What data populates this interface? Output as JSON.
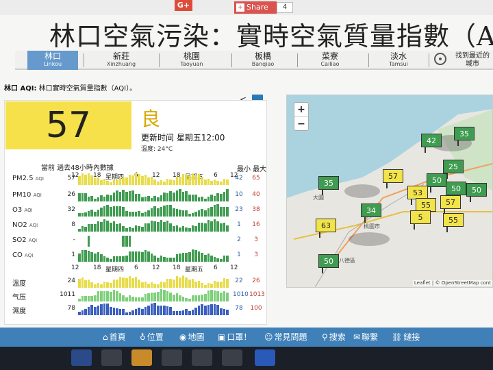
{
  "toolbar": {
    "gplus": "G+",
    "share_label": "Share",
    "share_count": "4"
  },
  "page_title": "林口空氣污染：實時空氣質量指數（AQ",
  "nav": [
    {
      "zh": "林口",
      "en": "Linkou"
    },
    {
      "zh": "新莊",
      "en": "Xinzhuang"
    },
    {
      "zh": "桃園",
      "en": "Taoyuan"
    },
    {
      "zh": "板橋",
      "en": "Banqiao"
    },
    {
      "zh": "菜寮",
      "en": "Cailiao"
    },
    {
      "zh": "淡水",
      "en": "Tamsui"
    },
    {
      "zh": "找到最近的城市",
      "en": ""
    }
  ],
  "panel": {
    "heading_city": "林口 AQI:",
    "heading_text": "林口實時空氣質量指數（AQI）。",
    "aqi": "57",
    "level": "良",
    "updated": "更新时间 星期五12:00",
    "temperature": "溫度: 24°C",
    "chart_heading": "當前  過去48小時內數據",
    "minmax_heading": "最小 最大",
    "ticks_top": [
      "12",
      "18",
      "星期四",
      "6",
      "12",
      "18",
      "星期五",
      "6",
      "12"
    ],
    "ticks_mid": [
      "12",
      "18",
      "星期四",
      "6",
      "12",
      "18",
      "星期五",
      "6",
      "12"
    ],
    "rows": [
      {
        "label": "PM2.5",
        "unit": "AQI",
        "current": "57",
        "min": "42",
        "max": "65",
        "color": "#e8dc4a"
      },
      {
        "label": "PM10",
        "unit": "AQI",
        "current": "26",
        "min": "10",
        "max": "40",
        "color": "#3f9c50"
      },
      {
        "label": "O3",
        "unit": "AQI",
        "current": "32",
        "min": "23",
        "max": "38",
        "color": "#3f9c50"
      },
      {
        "label": "NO2",
        "unit": "AQI",
        "current": "8",
        "min": "1",
        "max": "16",
        "color": "#3f9c50"
      },
      {
        "label": "SO2",
        "unit": "AQI",
        "current": "-",
        "min": "2",
        "max": "3",
        "color": "#3f9c50"
      },
      {
        "label": "CO",
        "unit": "AQI",
        "current": "1",
        "min": "1",
        "max": "3",
        "color": "#3f9c50"
      },
      {
        "label": "溫度",
        "unit": "",
        "current": "24",
        "min": "22",
        "max": "26",
        "color": "#e8dc4a"
      },
      {
        "label": "气压",
        "unit": "",
        "current": "1011",
        "min": "1010",
        "max": "1013",
        "color": "#7ed07a"
      },
      {
        "label": "濕度",
        "unit": "",
        "current": "78",
        "min": "78",
        "max": "100",
        "color": "#3a5fbf"
      }
    ]
  },
  "map": {
    "zoom_in": "+",
    "zoom_out": "−",
    "attribution": "Leaflet | © OpenStreetMap cont",
    "labels": {
      "taoyuan": "桃園市",
      "bade": "八德區",
      "dayuan": "大園"
    },
    "markers": [
      {
        "value": "42",
        "level": "g"
      },
      {
        "value": "35",
        "level": "g"
      },
      {
        "value": "25",
        "level": "g"
      },
      {
        "value": "35",
        "level": "g"
      },
      {
        "value": "57",
        "level": "y"
      },
      {
        "value": "50",
        "level": "g"
      },
      {
        "value": "50",
        "level": "g"
      },
      {
        "value": "50",
        "level": "g"
      },
      {
        "value": "53",
        "level": "y"
      },
      {
        "value": "55",
        "level": "y"
      },
      {
        "value": "57",
        "level": "y"
      },
      {
        "value": "34",
        "level": "g"
      },
      {
        "value": "5",
        "level": "y"
      },
      {
        "value": "55",
        "level": "y"
      },
      {
        "value": "63",
        "level": "y"
      },
      {
        "value": "50",
        "level": "g"
      }
    ]
  },
  "bottom_nav": [
    {
      "label": "首頁"
    },
    {
      "label": "位置"
    },
    {
      "label": "地圖"
    },
    {
      "label": "口罩！"
    },
    {
      "label": "常見問題"
    },
    {
      "label": "搜索"
    },
    {
      "label": "聯繫"
    },
    {
      "label": "鏈接"
    }
  ],
  "colors": {
    "good_yellow": "#f6e14b",
    "green": "#3f9c50",
    "nav_active": "#6699cc",
    "bottom_nav": "#3f80b8"
  }
}
